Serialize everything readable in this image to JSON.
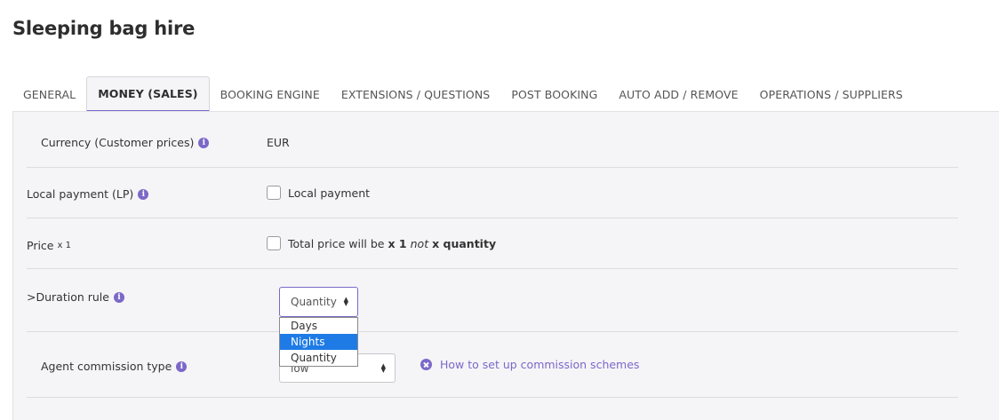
{
  "page": {
    "title": "Sleeping bag hire"
  },
  "tabs": [
    {
      "label": "GENERAL"
    },
    {
      "label": "MONEY (SALES)"
    },
    {
      "label": "BOOKING ENGINE"
    },
    {
      "label": "EXTENSIONS / QUESTIONS"
    },
    {
      "label": "POST BOOKING"
    },
    {
      "label": "AUTO ADD / REMOVE"
    },
    {
      "label": "OPERATIONS / SUPPLIERS"
    }
  ],
  "active_tab": "MONEY (SALES)",
  "form": {
    "currency": {
      "label": "Currency (Customer prices)",
      "value": "EUR"
    },
    "local_payment": {
      "label": "Local payment (LP)",
      "checkbox_label": "Local payment",
      "checked": false
    },
    "price_x1": {
      "label": "Price",
      "label_suffix": "x 1",
      "checked": false,
      "text_before": "Total price will be",
      "text_bold1": "x 1",
      "text_italic": "not",
      "text_bold2": "x quantity"
    },
    "duration_rule": {
      "label": ">Duration rule",
      "selected": "Quantity",
      "options": [
        "Days",
        "Nights",
        "Quantity"
      ],
      "highlighted_option": "Nights"
    },
    "agent_commission": {
      "label": "Agent commission type",
      "selected_partial": "low",
      "help_link": "How to set up commission schemes"
    }
  },
  "colors": {
    "accent": "#7b68c8",
    "highlight": "#1e7be6",
    "panel_bg": "#f5f5f7"
  },
  "icons": {
    "info": "info-icon",
    "help": "close-circle-icon"
  }
}
